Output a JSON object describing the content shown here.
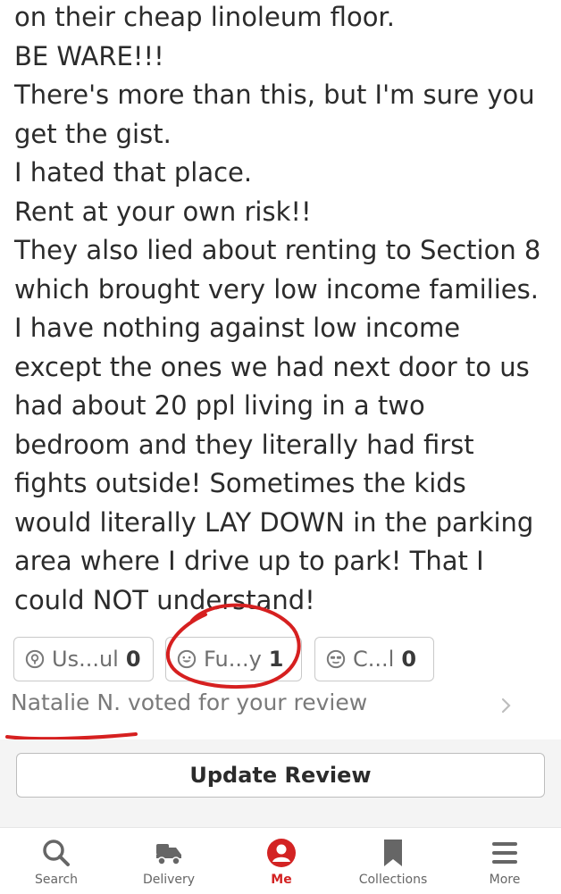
{
  "review": {
    "lines": [
      "on their cheap linoleum floor.",
      "BE WARE!!!",
      "There's more than this, but I'm sure you",
      "get the gist.",
      "I hated that place.",
      "Rent at your own risk!!",
      "They also lied about renting to Section 8",
      "which brought very low income families.",
      "I have nothing against low income",
      "except the ones we had next door to us",
      "had about 20 ppl living in a two",
      "bedroom and they literally had first",
      "fights outside! Sometimes the kids",
      "would literally LAY DOWN in the parking",
      "area where I drive up to park! That I",
      "could NOT understand!"
    ]
  },
  "votes": [
    {
      "label": "Us...ul",
      "count": "0",
      "icon": "useful-icon"
    },
    {
      "label": "Fu...y",
      "count": "1",
      "icon": "funny-icon"
    },
    {
      "label": "C...l",
      "count": "0",
      "icon": "cool-icon"
    }
  ],
  "voted_text": "Natalie N. voted for your review",
  "update_button": "Update Review",
  "tabs": [
    {
      "label": "Search",
      "icon": "search-icon",
      "active": false
    },
    {
      "label": "Delivery",
      "icon": "delivery-icon",
      "active": false
    },
    {
      "label": "Me",
      "icon": "profile-icon",
      "active": true
    },
    {
      "label": "Collections",
      "icon": "bookmark-icon",
      "active": false
    },
    {
      "label": "More",
      "icon": "menu-icon",
      "active": false
    }
  ],
  "colors": {
    "accent": "#d32323",
    "annotation": "#d62020",
    "text": "#2b2b2b",
    "muted": "#7a7a7a"
  }
}
